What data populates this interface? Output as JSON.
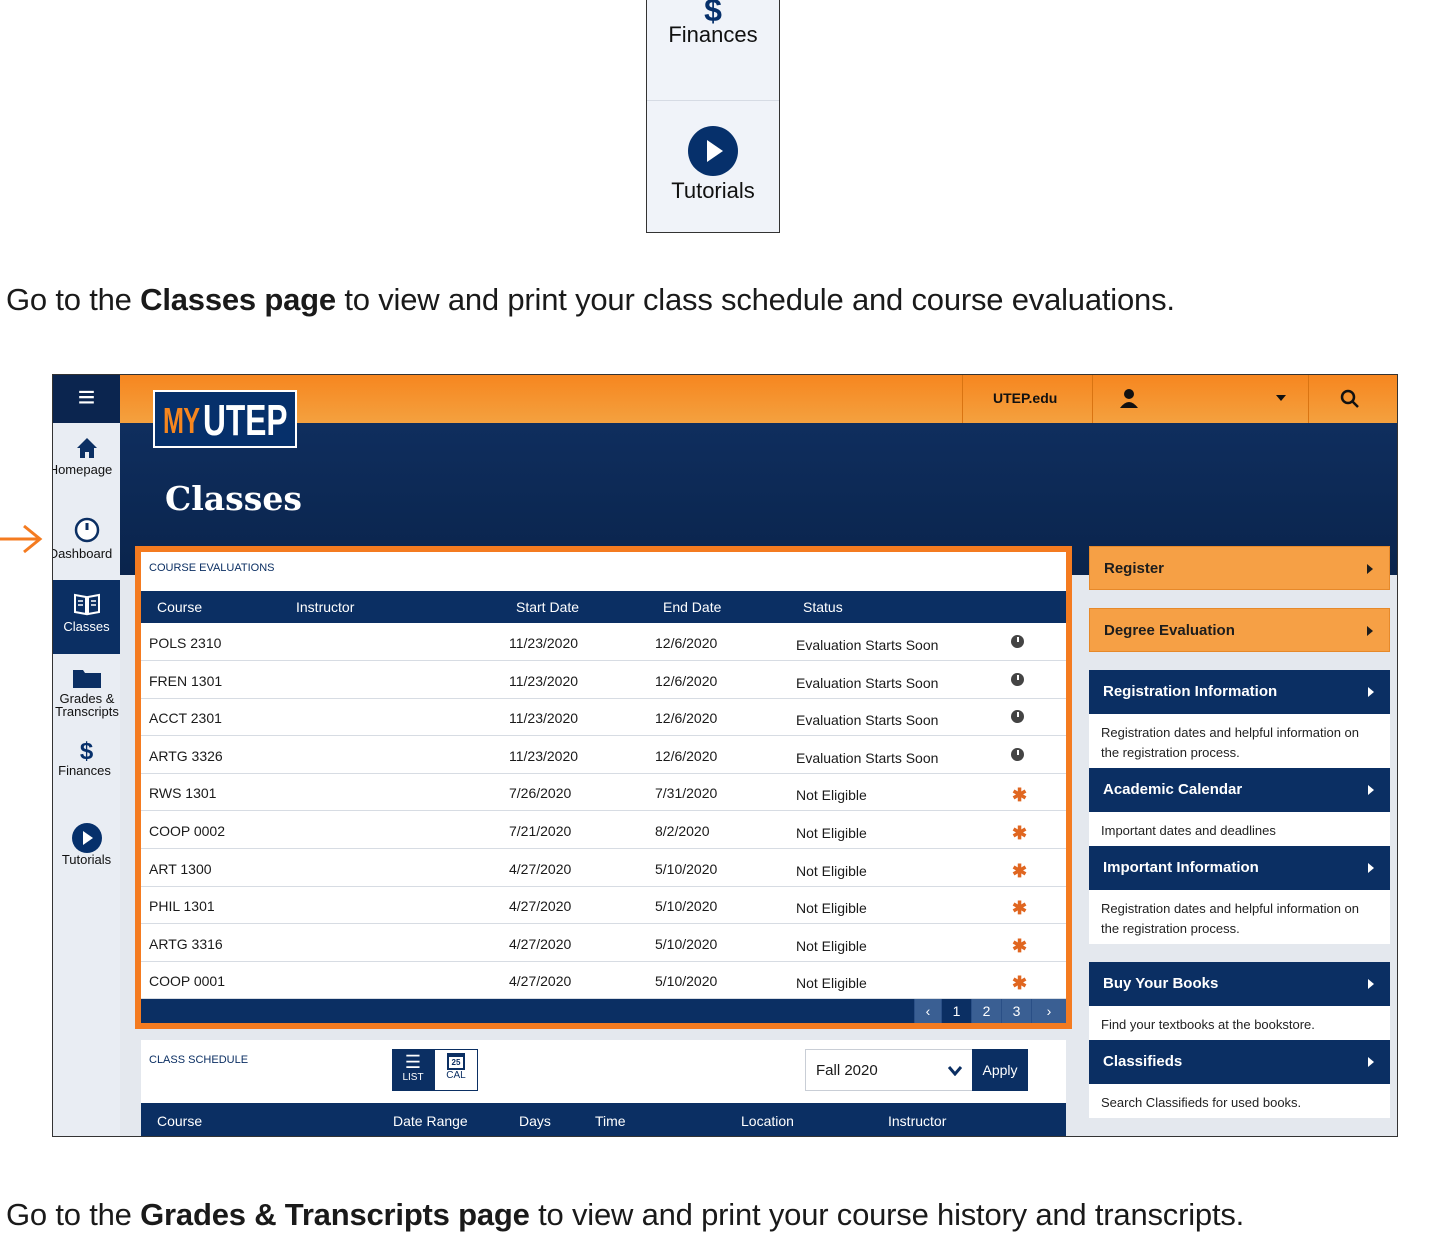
{
  "snippet": {
    "finances_label": "Finances",
    "tutorials_label": "Tutorials"
  },
  "caption_top": {
    "pre": "Go to the ",
    "bold": "Classes page",
    "post": " to view and print your class schedule and course evaluations."
  },
  "caption_bottom": {
    "pre": "Go to the ",
    "bold": "Grades & Transcripts page",
    "post": " to view and print your course history and transcripts."
  },
  "header": {
    "logo_my": "MY",
    "logo_utep": "UTEP",
    "utep_link": "UTEP.edu",
    "page_title": "Classes"
  },
  "sidebar": {
    "items": [
      {
        "label": "Homepage",
        "icon": "home-icon"
      },
      {
        "label": "Dashboard",
        "icon": "dashboard-icon"
      },
      {
        "label": "Classes",
        "icon": "book-icon"
      },
      {
        "label": "Grades & Transcripts",
        "icon": "folder-icon"
      },
      {
        "label": "Finances",
        "icon": "dollar-icon"
      },
      {
        "label": "Tutorials",
        "icon": "play-icon"
      }
    ]
  },
  "evaluations": {
    "title": "COURSE EVALUATIONS",
    "columns": [
      "Course",
      "Instructor",
      "Start Date",
      "End Date",
      "Status"
    ],
    "rows": [
      {
        "course": "POLS 2310",
        "start": "11/23/2020",
        "end": "12/6/2020",
        "status": "Evaluation Starts Soon",
        "icon": "clock-icon"
      },
      {
        "course": "FREN 1301",
        "start": "11/23/2020",
        "end": "12/6/2020",
        "status": "Evaluation Starts Soon",
        "icon": "clock-icon"
      },
      {
        "course": "ACCT 2301",
        "start": "11/23/2020",
        "end": "12/6/2020",
        "status": "Evaluation Starts Soon",
        "icon": "clock-icon"
      },
      {
        "course": "ARTG 3326",
        "start": "11/23/2020",
        "end": "12/6/2020",
        "status": "Evaluation Starts Soon",
        "icon": "clock-icon"
      },
      {
        "course": "RWS 1301",
        "start": "7/26/2020",
        "end": "7/31/2020",
        "status": "Not Eligible",
        "icon": "asterisk-icon"
      },
      {
        "course": "COOP 0002",
        "start": "7/21/2020",
        "end": "8/2/2020",
        "status": "Not Eligible",
        "icon": "asterisk-icon"
      },
      {
        "course": "ART 1300",
        "start": "4/27/2020",
        "end": "5/10/2020",
        "status": "Not Eligible",
        "icon": "asterisk-icon"
      },
      {
        "course": "PHIL 1301",
        "start": "4/27/2020",
        "end": "5/10/2020",
        "status": "Not Eligible",
        "icon": "asterisk-icon"
      },
      {
        "course": "ARTG 3316",
        "start": "4/27/2020",
        "end": "5/10/2020",
        "status": "Not Eligible",
        "icon": "asterisk-icon"
      },
      {
        "course": "COOP 0001",
        "start": "4/27/2020",
        "end": "5/10/2020",
        "status": "Not Eligible",
        "icon": "asterisk-icon"
      }
    ],
    "pages": [
      "1",
      "2",
      "3"
    ],
    "prev": "‹",
    "next": "›"
  },
  "schedule": {
    "title": "CLASS SCHEDULE",
    "list_label": "LIST",
    "cal_label": "CAL",
    "cal_day": "25",
    "term": "Fall 2020",
    "apply_label": "Apply",
    "columns": [
      "Course",
      "Date Range",
      "Days",
      "Time",
      "Location",
      "Instructor"
    ]
  },
  "right": {
    "register": "Register",
    "degree_eval": "Degree Evaluation",
    "reg_info": "Registration Information",
    "reg_info_desc": "Registration dates and helpful information on the registration process.",
    "acad_cal": "Academic Calendar",
    "acad_cal_desc": "Important dates and deadlines",
    "important": "Important Information",
    "important_desc": "Registration dates and helpful information on the registration process.",
    "books": "Buy Your Books",
    "books_desc": "Find your textbooks at the bookstore.",
    "classifieds": "Classifieds",
    "classifieds_desc": "Search Classifieds for used books."
  },
  "colors": {
    "orange": "#f6861f",
    "navy": "#0b2f63",
    "highlight": "#f47b20"
  }
}
